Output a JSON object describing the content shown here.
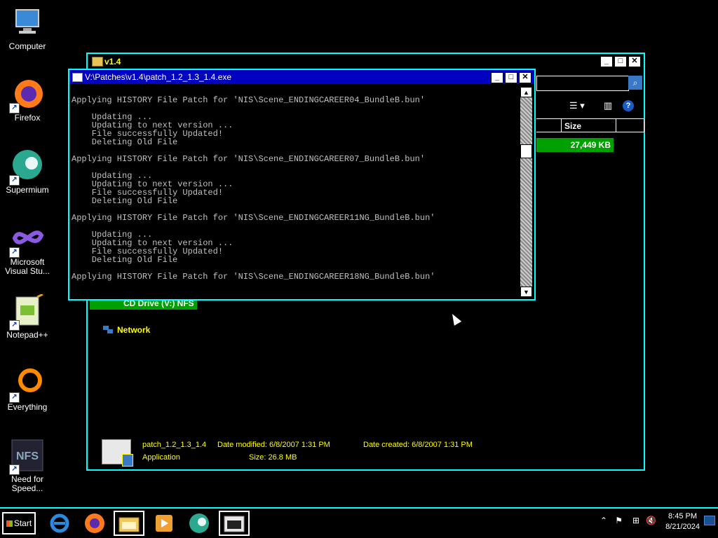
{
  "desktop": {
    "icons": [
      {
        "label": "Computer",
        "icon": "computer-icon"
      },
      {
        "label": "Firefox",
        "icon": "firefox-icon"
      },
      {
        "label": "Supermium",
        "icon": "supermium-icon"
      },
      {
        "label": "Microsoft Visual Stu...",
        "icon": "visual-studio-icon"
      },
      {
        "label": "Notepad++",
        "icon": "notepadpp-icon"
      },
      {
        "label": "Everything",
        "icon": "everything-icon"
      },
      {
        "label": "Need for Speed...",
        "icon": "nfs-icon"
      }
    ]
  },
  "explorer": {
    "title": "v1.4",
    "columns": [
      "Size"
    ],
    "size_value": "27,449 KB",
    "cd_drive": "CD Drive (V:) NFS",
    "network": "Network",
    "details": {
      "filename": "patch_1.2_1.3_1.4",
      "type": "Application",
      "date_modified": "Date modified: 6/8/2007 1:31 PM",
      "date_created": "Date created: 6/8/2007 1:31 PM",
      "size": "Size: 26.8 MB"
    }
  },
  "console": {
    "title": "V:\\Patches\\v1.4\\patch_1.2_1.3_1.4.exe",
    "lines": [
      "",
      "Applying HISTORY File Patch for 'NIS\\Scene_ENDINGCAREER04_BundleB.bun'",
      "",
      "    Updating ...",
      "    Updating to next version ...",
      "    File successfully Updated!",
      "    Deleting Old File",
      "",
      "Applying HISTORY File Patch for 'NIS\\Scene_ENDINGCAREER07_BundleB.bun'",
      "",
      "    Updating ...",
      "    Updating to next version ...",
      "    File successfully Updated!",
      "    Deleting Old File",
      "",
      "Applying HISTORY File Patch for 'NIS\\Scene_ENDINGCAREER11NG_BundleB.bun'",
      "",
      "    Updating ...",
      "    Updating to next version ...",
      "    File successfully Updated!",
      "    Deleting Old File",
      "",
      "Applying HISTORY File Patch for 'NIS\\Scene_ENDINGCAREER18NG_BundleB.bun'"
    ]
  },
  "taskbar": {
    "start_label": "Start",
    "time": "8:45 PM",
    "date": "8/21/2024"
  }
}
